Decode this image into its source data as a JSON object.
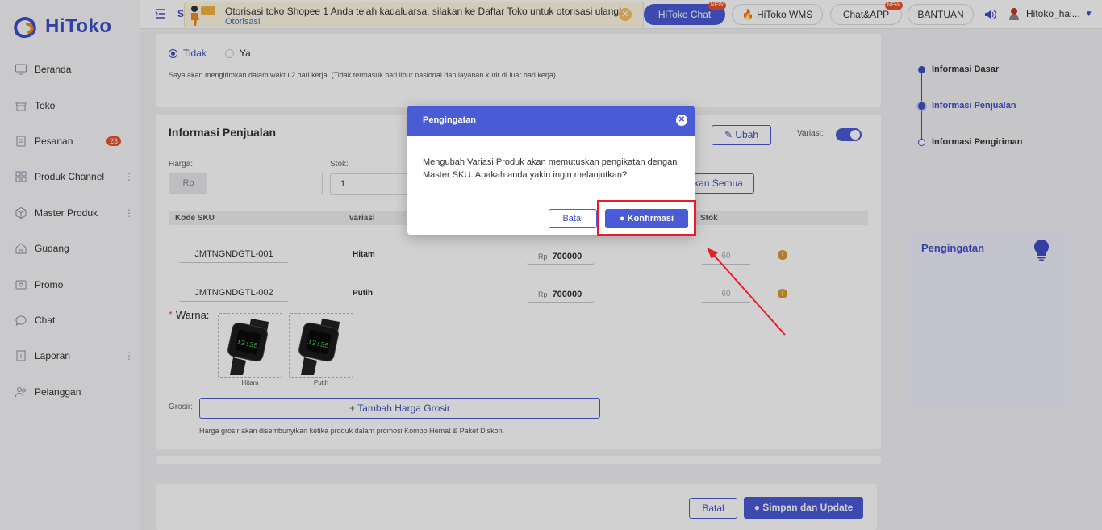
{
  "brand": {
    "name": "HiToko",
    "color": "#3d4fc8"
  },
  "sidebar": {
    "items": [
      {
        "label": "Beranda",
        "icon": "monitor-icon"
      },
      {
        "label": "Toko",
        "icon": "store-icon"
      },
      {
        "label": "Pesanan",
        "icon": "clipboard-icon",
        "badge": "23"
      },
      {
        "label": "Produk Channel",
        "icon": "grid-icon",
        "more": "⋮"
      },
      {
        "label": "Master Produk",
        "icon": "box-icon",
        "more": "⋮"
      },
      {
        "label": "Gudang",
        "icon": "warehouse-icon"
      },
      {
        "label": "Promo",
        "icon": "ticket-icon"
      },
      {
        "label": "Chat",
        "icon": "chat-icon"
      },
      {
        "label": "Laporan",
        "icon": "report-icon",
        "more": "⋮"
      },
      {
        "label": "Pelanggan",
        "icon": "users-icon"
      }
    ]
  },
  "topbar": {
    "menu_letter": "S",
    "notice": {
      "message": "Otorisasi toko Shopee 1 Anda telah kadaluarsa, silakan ke Daftar Toko untuk otorisasi ulang!",
      "link": "Otorisasi"
    },
    "hitoko_chat": "HiToko Chat",
    "hitoko_wms": "HiToko WMS",
    "chat_app": "Chat&APP",
    "bantuan": "BANTUAN",
    "new_tag": "NEW",
    "username": "Hitoko_hai..."
  },
  "shipping": {
    "option_no": "Tidak",
    "option_yes": "Ya",
    "note": "Saya akan mengirimkan dalam waktu 2 hari kerja. (Tidak termasuk hari libur nasional dan layanan kurir di luar hari kerja)"
  },
  "sales": {
    "title": "Informasi Penjualan",
    "ubah": "Ubah",
    "variasi_label": "Variasi:",
    "harga_label": "Harga:",
    "stok_label": "Stok:",
    "currency": "Rp",
    "stok_value": "1",
    "apply_all": "kan Semua",
    "columns": {
      "kode": "Kode SKU",
      "variasi": "variasi",
      "stok": "Stok"
    },
    "rows": [
      {
        "sku": "JMTNGNDGTL-001",
        "variant": "Hitam",
        "price": "700000",
        "stock": "60"
      },
      {
        "sku": "JMTNGNDGTL-002",
        "variant": "Putih",
        "price": "700000",
        "stock": "60"
      }
    ],
    "warna_label": "Warna:",
    "warna_required": "*",
    "warna": [
      "Hitam",
      "Putih"
    ],
    "grosir_label": "Grosir:",
    "grosir_button": "Tambah Harga Grosir",
    "grosir_note": "Harga grosir akan disembunyikan ketika produk dalam promosi Kombo Hemat & Paket Diskon."
  },
  "footer": {
    "batal": "Batal",
    "simpan": "Simpan dan Update"
  },
  "steps": [
    "Informasi Dasar",
    "Informasi Penjualan",
    "Informasi Pengiriman"
  ],
  "tip_panel": {
    "title": "Pengingatan"
  },
  "modal": {
    "title": "Pengingatan",
    "body": "Mengubah Variasi Produk akan memutuskan pengikatan dengan Master SKU. Apakah anda yakin ingin melanjutkan?",
    "cancel": "Batal",
    "confirm": "Konfirmasi"
  }
}
